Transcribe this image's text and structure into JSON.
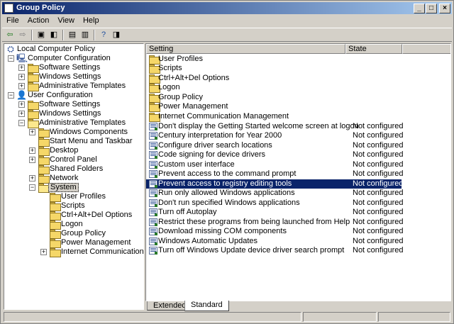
{
  "window": {
    "title": "Group Policy"
  },
  "menu": [
    {
      "label": "File"
    },
    {
      "label": "Action"
    },
    {
      "label": "View"
    },
    {
      "label": "Help"
    }
  ],
  "tree": [
    {
      "label": "Local Computer Policy",
      "icon": "computer-policy-icon"
    },
    {
      "label": "Computer Configuration",
      "icon": "computer-icon"
    },
    {
      "label": "Software Settings"
    },
    {
      "label": "Windows Settings"
    },
    {
      "label": "Administrative Templates"
    },
    {
      "label": "User Configuration",
      "icon": "user-icon"
    },
    {
      "label": "Software Settings"
    },
    {
      "label": "Windows Settings"
    },
    {
      "label": "Administrative Templates"
    },
    {
      "label": "Windows Components"
    },
    {
      "label": "Start Menu and Taskbar"
    },
    {
      "label": "Desktop"
    },
    {
      "label": "Control Panel"
    },
    {
      "label": "Shared Folders"
    },
    {
      "label": "Network"
    },
    {
      "label": "System",
      "selected": true
    },
    {
      "label": "User Profiles"
    },
    {
      "label": "Scripts"
    },
    {
      "label": "Ctrl+Alt+Del Options"
    },
    {
      "label": "Logon"
    },
    {
      "label": "Group Policy"
    },
    {
      "label": "Power Management"
    },
    {
      "label": "Internet Communication Mana"
    }
  ],
  "list": {
    "columns": [
      {
        "label": "Setting"
      },
      {
        "label": "State"
      }
    ],
    "folders": [
      {
        "label": "User Profiles"
      },
      {
        "label": "Scripts"
      },
      {
        "label": "Ctrl+Alt+Del Options"
      },
      {
        "label": "Logon"
      },
      {
        "label": "Group Policy"
      },
      {
        "label": "Power Management"
      },
      {
        "label": "Internet Communication Management"
      }
    ],
    "settings": [
      {
        "label": "Don't display the Getting Started welcome screen at logon",
        "state": "Not configured"
      },
      {
        "label": "Century interpretation for Year 2000",
        "state": "Not configured"
      },
      {
        "label": "Configure driver search locations",
        "state": "Not configured"
      },
      {
        "label": "Code signing for device drivers",
        "state": "Not configured"
      },
      {
        "label": "Custom user interface",
        "state": "Not configured"
      },
      {
        "label": "Prevent access to the command prompt",
        "state": "Not configured"
      },
      {
        "label": "Prevent access to registry editing tools",
        "state": "Not configured",
        "selected": true
      },
      {
        "label": "Run only allowed Windows applications",
        "state": "Not configured"
      },
      {
        "label": "Don't run specified Windows applications",
        "state": "Not configured"
      },
      {
        "label": "Turn off Autoplay",
        "state": "Not configured"
      },
      {
        "label": "Restrict these programs from being launched from Help",
        "state": "Not configured"
      },
      {
        "label": "Download missing COM components",
        "state": "Not configured"
      },
      {
        "label": "Windows Automatic Updates",
        "state": "Not configured"
      },
      {
        "label": "Turn off Windows Update device driver search prompt",
        "state": "Not configured"
      }
    ]
  },
  "tabs": [
    {
      "label": "Extended"
    },
    {
      "label": "Standard",
      "active": true
    }
  ],
  "colors": {
    "titlebar": "#0a246a",
    "selection": "#0a246a",
    "chrome": "#d4d0c8"
  }
}
